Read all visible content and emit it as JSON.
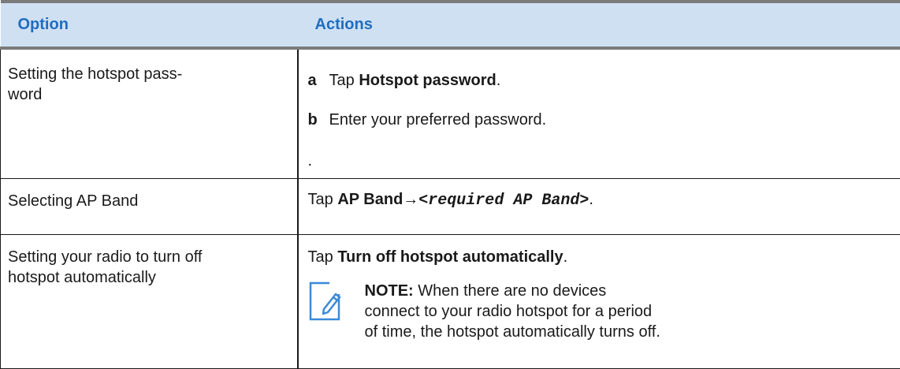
{
  "table": {
    "header": {
      "option": "Option",
      "actions": "Actions"
    },
    "rows": [
      {
        "option": "Setting the hotspot pass-\nword",
        "steps": [
          {
            "letter": "a",
            "pre": "Tap ",
            "bold": "Hotspot password",
            "post": "."
          },
          {
            "letter": "b",
            "text": "Enter your preferred password."
          }
        ],
        "trailing": "."
      },
      {
        "option": "Selecting AP Band",
        "pre": "Tap ",
        "bold": "AP Band",
        "arrow": "→",
        "mono": "<required AP Band>",
        "post": "."
      },
      {
        "option": "Setting your radio to turn off\nhotspot automatically",
        "pre": "Tap ",
        "bold": "Turn off hotspot automatically",
        "post": ".",
        "note": {
          "icon": "note-pencil-icon",
          "label": "NOTE:",
          "text": " When there are no devices connect to your radio hotspot for a period of time, the hotspot automatically turns off."
        }
      }
    ]
  }
}
